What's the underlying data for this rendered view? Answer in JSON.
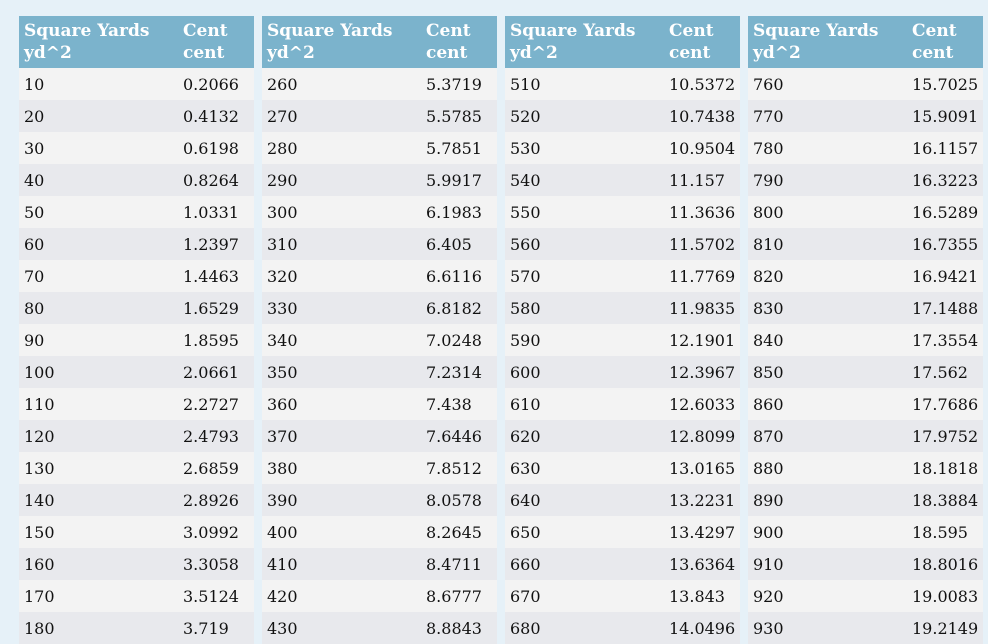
{
  "headers": {
    "col1_line1": "Square Yards",
    "col1_line2": "yd^2",
    "col2_line1": "Cent",
    "col2_line2": "cent"
  },
  "tables": [
    {
      "rows": [
        [
          "10",
          "0.2066"
        ],
        [
          "20",
          "0.4132"
        ],
        [
          "30",
          "0.6198"
        ],
        [
          "40",
          "0.8264"
        ],
        [
          "50",
          "1.0331"
        ],
        [
          "60",
          "1.2397"
        ],
        [
          "70",
          "1.4463"
        ],
        [
          "80",
          "1.6529"
        ],
        [
          "90",
          "1.8595"
        ],
        [
          "100",
          "2.0661"
        ],
        [
          "110",
          "2.2727"
        ],
        [
          "120",
          "2.4793"
        ],
        [
          "130",
          "2.6859"
        ],
        [
          "140",
          "2.8926"
        ],
        [
          "150",
          "3.0992"
        ],
        [
          "160",
          "3.3058"
        ],
        [
          "170",
          "3.5124"
        ],
        [
          "180",
          "3.719"
        ]
      ]
    },
    {
      "rows": [
        [
          "260",
          "5.3719"
        ],
        [
          "270",
          "5.5785"
        ],
        [
          "280",
          "5.7851"
        ],
        [
          "290",
          "5.9917"
        ],
        [
          "300",
          "6.1983"
        ],
        [
          "310",
          "6.405"
        ],
        [
          "320",
          "6.6116"
        ],
        [
          "330",
          "6.8182"
        ],
        [
          "340",
          "7.0248"
        ],
        [
          "350",
          "7.2314"
        ],
        [
          "360",
          "7.438"
        ],
        [
          "370",
          "7.6446"
        ],
        [
          "380",
          "7.8512"
        ],
        [
          "390",
          "8.0578"
        ],
        [
          "400",
          "8.2645"
        ],
        [
          "410",
          "8.4711"
        ],
        [
          "420",
          "8.6777"
        ],
        [
          "430",
          "8.8843"
        ]
      ]
    },
    {
      "rows": [
        [
          "510",
          "10.5372"
        ],
        [
          "520",
          "10.7438"
        ],
        [
          "530",
          "10.9504"
        ],
        [
          "540",
          "11.157"
        ],
        [
          "550",
          "11.3636"
        ],
        [
          "560",
          "11.5702"
        ],
        [
          "570",
          "11.7769"
        ],
        [
          "580",
          "11.9835"
        ],
        [
          "590",
          "12.1901"
        ],
        [
          "600",
          "12.3967"
        ],
        [
          "610",
          "12.6033"
        ],
        [
          "620",
          "12.8099"
        ],
        [
          "630",
          "13.0165"
        ],
        [
          "640",
          "13.2231"
        ],
        [
          "650",
          "13.4297"
        ],
        [
          "660",
          "13.6364"
        ],
        [
          "670",
          "13.843"
        ],
        [
          "680",
          "14.0496"
        ]
      ]
    },
    {
      "rows": [
        [
          "760",
          "15.7025"
        ],
        [
          "770",
          "15.9091"
        ],
        [
          "780",
          "16.1157"
        ],
        [
          "790",
          "16.3223"
        ],
        [
          "800",
          "16.5289"
        ],
        [
          "810",
          "16.7355"
        ],
        [
          "820",
          "16.9421"
        ],
        [
          "830",
          "17.1488"
        ],
        [
          "840",
          "17.3554"
        ],
        [
          "850",
          "17.562"
        ],
        [
          "860",
          "17.7686"
        ],
        [
          "870",
          "17.9752"
        ],
        [
          "880",
          "18.1818"
        ],
        [
          "890",
          "18.3884"
        ],
        [
          "900",
          "18.595"
        ],
        [
          "910",
          "18.8016"
        ],
        [
          "920",
          "19.0083"
        ],
        [
          "930",
          "19.2149"
        ]
      ]
    }
  ]
}
